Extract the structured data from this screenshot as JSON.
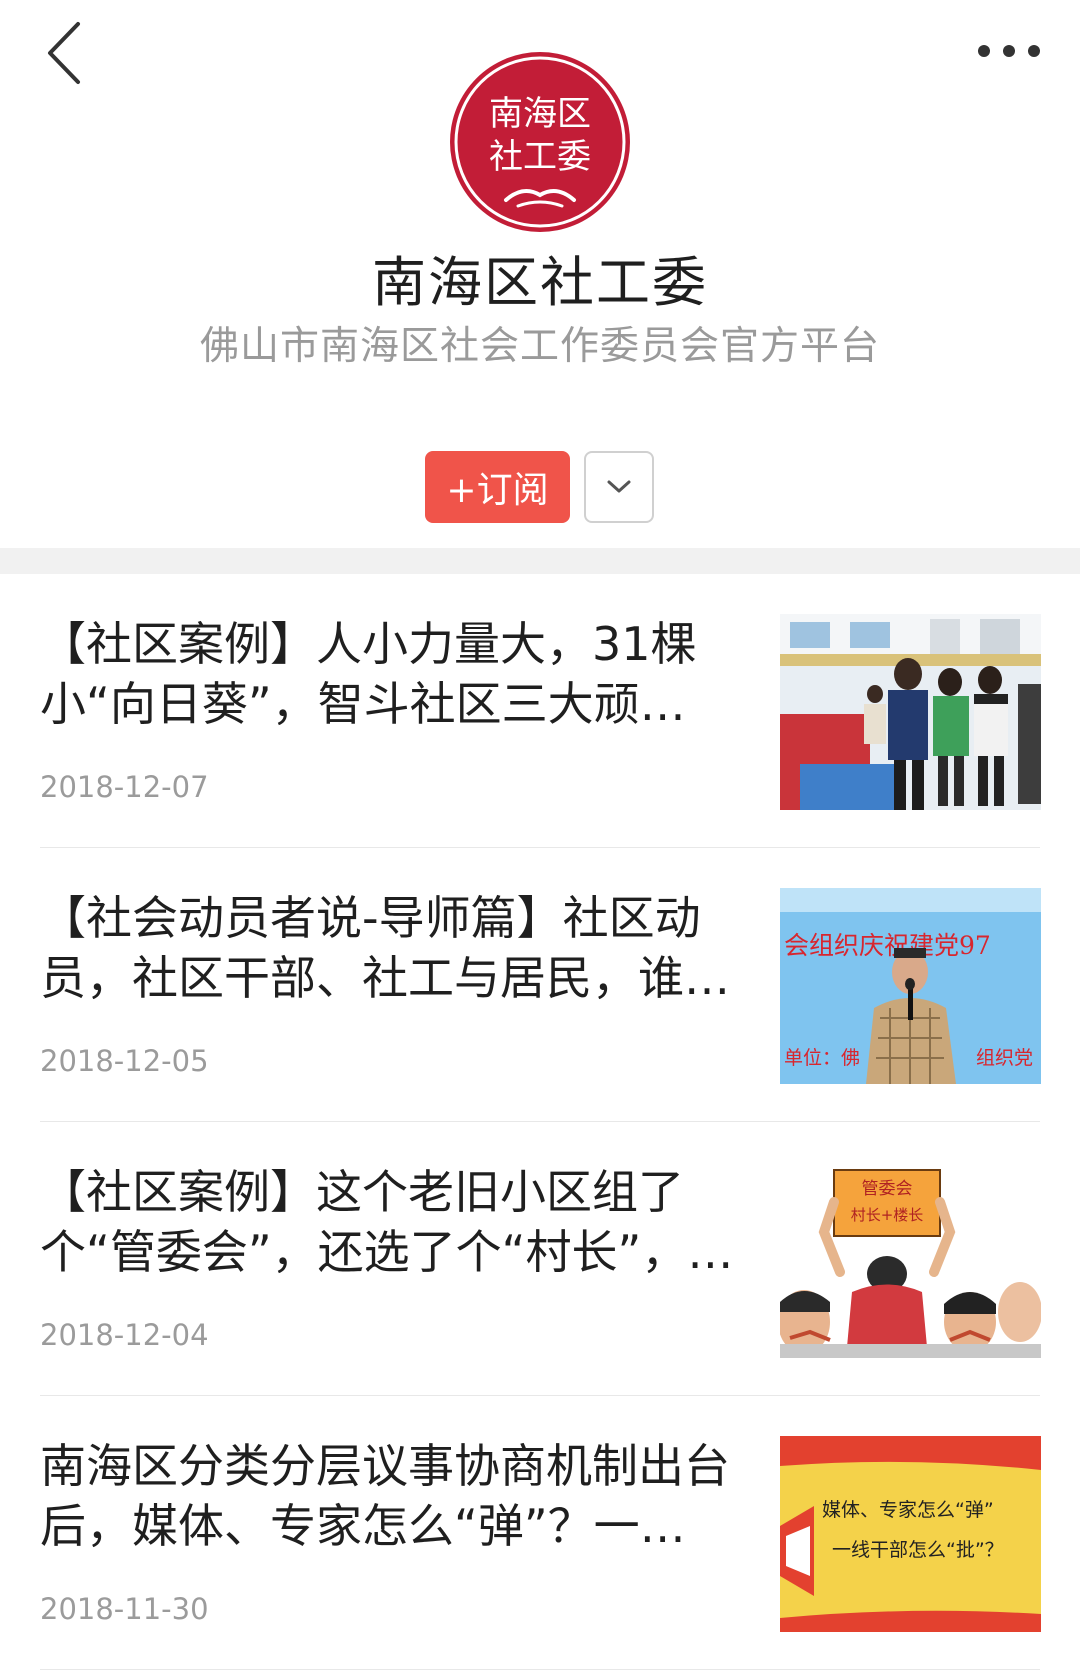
{
  "header": {
    "back_icon": "chevron-left-icon",
    "more_icon": "more-dots-icon"
  },
  "account": {
    "logo_line1": "南海区",
    "logo_line2": "社工委",
    "name": "南海区社工委",
    "description": "佛山市南海区社会工作委员会官方平台",
    "brand_color": "#c21d37"
  },
  "actions": {
    "subscribe_label": "+订阅",
    "subscribe_color": "#f0544a",
    "dropdown_icon": "chevron-down-icon"
  },
  "articles": [
    {
      "title": "【社区案例】人小力量大，31棵小“向日葵”，智斗社区三大顽…",
      "date": "2018-12-07"
    },
    {
      "title": "【社会动员者说-导师篇】社区动员，社区干部、社工与居民，谁…",
      "date": "2018-12-05"
    },
    {
      "title": "【社区案例】这个老旧小区组了个“管委会”，还选了个“村长”，…",
      "date": "2018-12-04"
    },
    {
      "title": "南海区分类分层议事协商机制出台后，媒体、专家怎么“弹”？一…",
      "date": "2018-11-30"
    }
  ],
  "thumb_texts": {
    "t2_banner": "会组织庆祝建党97",
    "t2_unit": "单位：佛",
    "t2_org": "组织党",
    "t3_sign_1": "管委会",
    "t3_sign_2": "村长+楼长",
    "t4_line1": "媒体、专家怎么“弹”",
    "t4_line2": "一线干部怎么“批”？"
  }
}
